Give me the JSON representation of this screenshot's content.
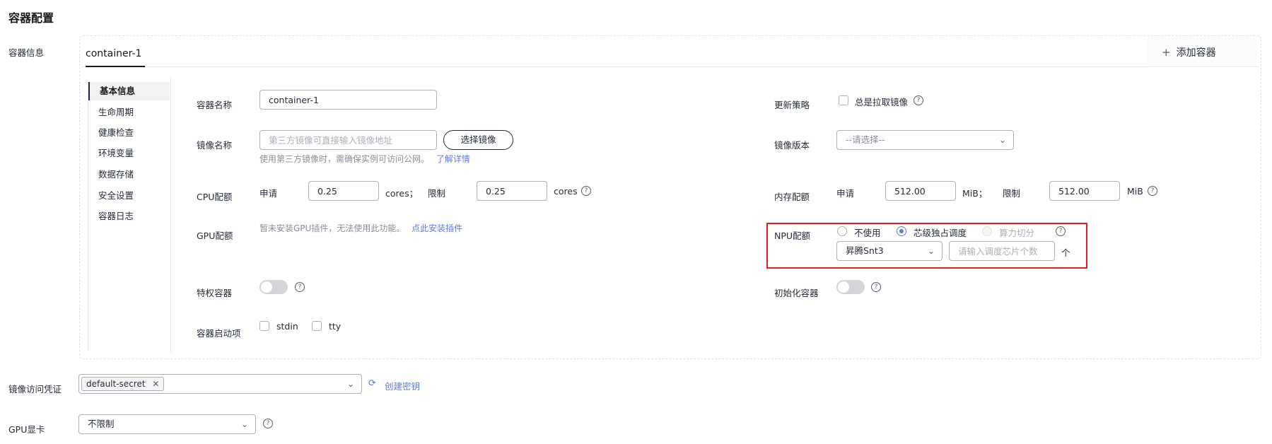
{
  "section_title": "容器配置",
  "container_info_label": "容器信息",
  "tabs": {
    "active": "container-1",
    "add_label": "添加容器"
  },
  "nav": [
    "基本信息",
    "生命周期",
    "健康检查",
    "环境变量",
    "数据存储",
    "安全设置",
    "容器日志"
  ],
  "form": {
    "container_name": {
      "label": "容器名称",
      "value": "container-1"
    },
    "update_policy": {
      "label": "更新策略",
      "checkbox_label": "总是拉取镜像"
    },
    "image_name": {
      "label": "镜像名称",
      "placeholder": "第三方镜像可直接输入镜像地址",
      "select_button": "选择镜像",
      "hint": "使用第三方镜像时，需确保实例可访问公网。",
      "hint_link": "了解详情"
    },
    "image_version": {
      "label": "镜像版本",
      "placeholder": "--请选择--"
    },
    "cpu": {
      "label": "CPU配额",
      "request_label": "申请",
      "request_value": "0.25",
      "request_unit": "cores；",
      "limit_label": "限制",
      "limit_value": "0.25",
      "limit_unit": "cores"
    },
    "memory": {
      "label": "内存配额",
      "request_label": "申请",
      "request_value": "512.00",
      "request_unit": "MiB；",
      "limit_label": "限制",
      "limit_value": "512.00",
      "limit_unit": "MiB"
    },
    "gpu": {
      "label": "GPU配额",
      "text": "暂未安装GPU插件，无法使用此功能。",
      "link": "点此安装插件"
    },
    "npu": {
      "label": "NPU配额",
      "options": [
        "不使用",
        "芯级独占调度",
        "算力切分"
      ],
      "selected": "芯级独占调度",
      "chip_select": "昇腾Snt3",
      "count_placeholder": "请输入调度芯片个数",
      "unit": "个"
    },
    "privileged": {
      "label": "特权容器"
    },
    "init_container": {
      "label": "初始化容器"
    },
    "startup_options": {
      "label": "容器启动项",
      "opt1": "stdin",
      "opt2": "tty"
    }
  },
  "image_credentials": {
    "label": "镜像访问凭证",
    "tag": "default-secret",
    "create_link": "创建密钥"
  },
  "gpu_card": {
    "label": "GPU显卡",
    "value": "不限制"
  },
  "icons": [
    "help-icon",
    "close-icon",
    "chevron-down-icon",
    "refresh-icon",
    "plus-icon"
  ]
}
